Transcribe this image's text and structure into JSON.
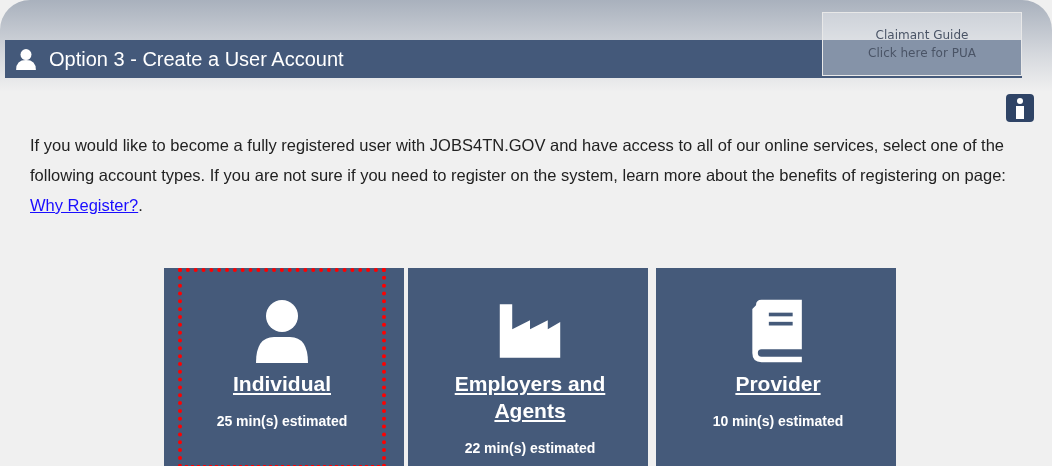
{
  "reflected_button": {
    "lines": [
      "Claimant Guide",
      "Click here for PUA"
    ]
  },
  "header": {
    "title": "Option 3 - Create a User Account"
  },
  "intro": {
    "text": "If you would like to become a fully registered user with JOBS4TN.GOV and have access to all of our online services, select one of the following account types. If you are not sure if you need to register on the system, learn more about the benefits of registering on page: ",
    "link": "Why Register?",
    "after": "."
  },
  "account_types": [
    {
      "kind": "person",
      "title": "Individual",
      "estimate": "25 min(s) estimated",
      "selected": true
    },
    {
      "kind": "factory",
      "title": "Employers and Agents",
      "estimate": "22 min(s) estimated",
      "selected": false
    },
    {
      "kind": "book",
      "title": "Provider",
      "estimate": "10 min(s) estimated",
      "selected": false
    }
  ]
}
